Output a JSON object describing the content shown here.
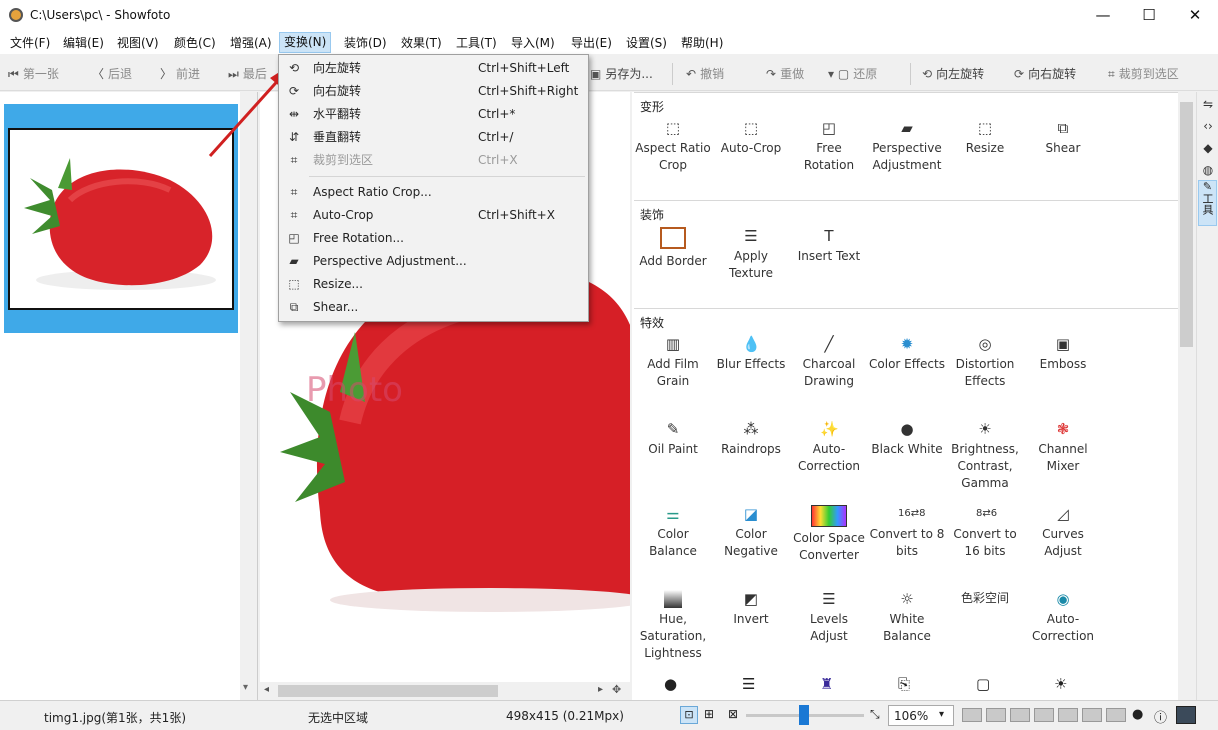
{
  "window": {
    "title": "C:\\Users\\pc\\ - Showfoto",
    "minimize": "—",
    "maximize": "☐",
    "close": "✕"
  },
  "menubar": [
    "文件(F)",
    "编辑(E)",
    "视图(V)",
    "颜色(C)",
    "增强(A)",
    "变换(N)",
    "装饰(D)",
    "效果(T)",
    "工具(T)",
    "导入(M)",
    "导出(E)",
    "设置(S)",
    "帮助(H)"
  ],
  "toolbar": {
    "first": "第一张",
    "back": "后退",
    "forward": "前进",
    "last": "最后",
    "save_as": "另存为...",
    "undo": "撤销",
    "redo": "重做",
    "restore": "还原",
    "rotate_left": "向左旋转",
    "rotate_right": "向右旋转",
    "crop": "裁剪到选区"
  },
  "transform_menu": [
    {
      "icon": "rotate-left-icon",
      "label": "向左旋转",
      "shortcut": "Ctrl+Shift+Left",
      "enabled": true
    },
    {
      "icon": "rotate-right-icon",
      "label": "向右旋转",
      "shortcut": "Ctrl+Shift+Right",
      "enabled": true
    },
    {
      "icon": "flip-horizontal-icon",
      "label": "水平翻转",
      "shortcut": "Ctrl+*",
      "enabled": true
    },
    {
      "icon": "flip-vertical-icon",
      "label": "垂直翻转",
      "shortcut": "Ctrl+/",
      "enabled": true
    },
    {
      "icon": "crop-icon",
      "label": "裁剪到选区",
      "shortcut": "Ctrl+X",
      "enabled": false
    },
    {
      "icon": "aspect-crop-icon",
      "label": "Aspect Ratio Crop...",
      "shortcut": "",
      "enabled": true
    },
    {
      "icon": "auto-crop-icon",
      "label": "Auto-Crop",
      "shortcut": "Ctrl+Shift+X",
      "enabled": true
    },
    {
      "icon": "free-rotation-icon",
      "label": "Free Rotation...",
      "shortcut": "",
      "enabled": true
    },
    {
      "icon": "perspective-icon",
      "label": "Perspective Adjustment...",
      "shortcut": "",
      "enabled": true
    },
    {
      "icon": "resize-icon",
      "label": "Resize...",
      "shortcut": "",
      "enabled": true
    },
    {
      "icon": "shear-icon",
      "label": "Shear...",
      "shortcut": "",
      "enabled": true
    }
  ],
  "sections": {
    "transform": {
      "title": "变形",
      "tools": [
        "Aspect Ratio Crop",
        "Auto-Crop",
        "Free Rotation",
        "Perspective Adjustment",
        "Resize",
        "Shear"
      ]
    },
    "decorate": {
      "title": "装饰",
      "tools": [
        "Add Border",
        "Apply Texture",
        "Insert Text"
      ]
    },
    "effects": {
      "title": "特效",
      "tools": [
        "Add Film Grain",
        "Blur Effects",
        "Charcoal Drawing",
        "Color Effects",
        "Distortion Effects",
        "Emboss",
        "Oil Paint",
        "Raindrops",
        "Auto-Correction",
        "Black White",
        "Brightness, Contrast, Gamma",
        "Channel Mixer",
        "Color Balance",
        "Color Negative",
        "Color Space Converter",
        "Convert to 8 bits",
        "Convert to 16 bits",
        "Curves Adjust",
        "Hue, Saturation, Lightness",
        "Invert",
        "Levels Adjust",
        "White Balance",
        "色彩空间",
        "Auto-Correction"
      ]
    }
  },
  "sidetabs": [
    "工具"
  ],
  "watermark": "Photo",
  "status": {
    "file": "timg1.jpg(第1张，共1张)",
    "selection": "无选中区域",
    "size": "498x415 (0.21Mpx)",
    "zoom": "106%"
  },
  "colors": {
    "selection": "#3fa9e8",
    "menu_highlight": "#cce4f7",
    "arrow": "#d02020"
  }
}
